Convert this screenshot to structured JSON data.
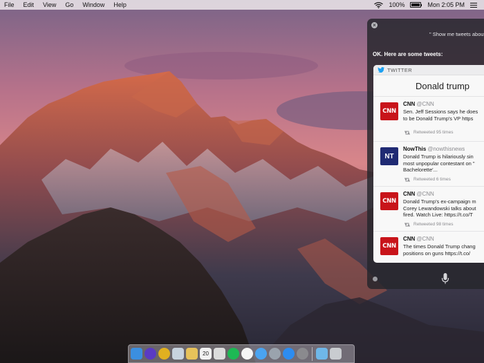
{
  "menubar": {
    "items": [
      "File",
      "Edit",
      "View",
      "Go",
      "Window",
      "Help"
    ],
    "battery": "100%",
    "clock": "Mon 2:05 PM"
  },
  "siri": {
    "query": "\" Show me tweets about",
    "reply": "OK. Here are some tweets:",
    "card": {
      "source": "TWITTER",
      "search_title": "Donald trump",
      "tweets": [
        {
          "avatar": "CNN",
          "name": "CNN",
          "handle": "@CNN",
          "lines": [
            "Sen. Jeff Sessions says he does",
            "to be Donald Trump's VP https"
          ],
          "retweets": "Retweeted 95 times"
        },
        {
          "avatar": "NT",
          "name": "NowThis",
          "handle": "@nowthisnews",
          "lines": [
            "Donald Trump is hilariously sin",
            "most unpopular contestant on \"",
            "Bachelorette'..."
          ],
          "retweets": "Retweeted 6 times"
        },
        {
          "avatar": "CNN",
          "name": "CNN",
          "handle": "@CNN",
          "lines": [
            "Donald Trump's ex-campaign m",
            "Corey Lewandowski talks about",
            "fired. Watch Live: https://t.co/T"
          ],
          "retweets": "Retweeted 98 times"
        },
        {
          "avatar": "CNN",
          "name": "CNN",
          "handle": "@CNN",
          "lines": [
            "The times Donald Trump chang",
            "positions on guns https://t.co/"
          ],
          "retweets": ""
        }
      ]
    }
  },
  "dock": {
    "apps": [
      {
        "name": "finder-icon",
        "color": "#3b8fe0"
      },
      {
        "name": "siri-icon",
        "color": "#5a3bc4"
      },
      {
        "name": "chrome-icon",
        "color": "#e0b020"
      },
      {
        "name": "preview-icon",
        "color": "#c7d3de"
      },
      {
        "name": "sketch-icon",
        "color": "#e7c25a"
      },
      {
        "name": "calendar-icon",
        "color": "#f2f2f2"
      },
      {
        "name": "notes-icon",
        "color": "#dcdcdc"
      },
      {
        "name": "spotify-icon",
        "color": "#1db954"
      },
      {
        "name": "photos-icon",
        "color": "#f5f5f5"
      },
      {
        "name": "messages-icon",
        "color": "#4aa3f0"
      },
      {
        "name": "launchpad-icon",
        "color": "#9aa3ad"
      },
      {
        "name": "app-store-icon",
        "color": "#2d8cf0"
      },
      {
        "name": "system-preferences-icon",
        "color": "#8a8a8e"
      },
      {
        "name": "downloads-folder-icon",
        "color": "#6fb7e8"
      },
      {
        "name": "trash-icon",
        "color": "#c9ccd0"
      }
    ],
    "calendar_day": "20"
  }
}
